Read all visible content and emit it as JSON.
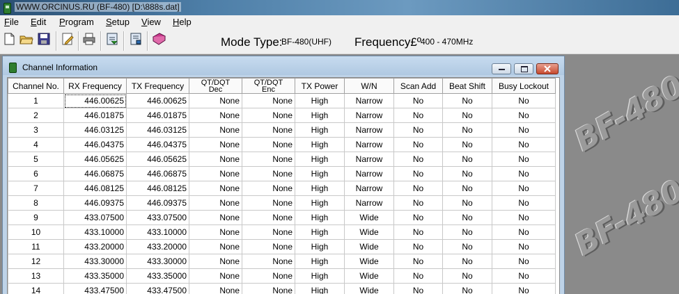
{
  "window": {
    "title": "WWW.ORCINUS.RU (BF-480) [D:\\888s.dat]"
  },
  "menu": [
    {
      "label": "File",
      "key": "F",
      "rest": "ile"
    },
    {
      "label": "Edit",
      "key": "E",
      "rest": "dit"
    },
    {
      "label": "Program",
      "key": "P",
      "rest": "rogram"
    },
    {
      "label": "Setup",
      "key": "S",
      "rest": "etup"
    },
    {
      "label": "View",
      "key": "V",
      "rest": "iew"
    },
    {
      "label": "Help",
      "key": "H",
      "rest": "elp"
    }
  ],
  "toolbar": {
    "icons": [
      "new-file-icon",
      "open-folder-icon",
      "save-icon",
      "edit-icon",
      "print-icon",
      "read-from-radio-icon",
      "write-to-radio-icon",
      "help-book-icon"
    ],
    "mode_label": "Mode Type:",
    "mode_value": "BF-480(UHF)",
    "freq_label": "Frequency£º",
    "freq_value": "400 - 470MHz"
  },
  "watermark": "BF-480",
  "child": {
    "title": "Channel Information",
    "columns": [
      "Channel No.",
      "RX Frequency",
      "TX Frequency",
      "QT/DQT Dec",
      "QT/DQT Enc",
      "TX Power",
      "W/N",
      "Scan Add",
      "Beat Shift",
      "Busy Lockout"
    ],
    "column_header_lines": {
      "3": [
        "QT/DQT",
        "Dec"
      ],
      "4": [
        "QT/DQT",
        "Enc"
      ]
    },
    "rows": [
      [
        "1",
        "446.00625",
        "446.00625",
        "None",
        "None",
        "High",
        "Narrow",
        "No",
        "No",
        "No"
      ],
      [
        "2",
        "446.01875",
        "446.01875",
        "None",
        "None",
        "High",
        "Narrow",
        "No",
        "No",
        "No"
      ],
      [
        "3",
        "446.03125",
        "446.03125",
        "None",
        "None",
        "High",
        "Narrow",
        "No",
        "No",
        "No"
      ],
      [
        "4",
        "446.04375",
        "446.04375",
        "None",
        "None",
        "High",
        "Narrow",
        "No",
        "No",
        "No"
      ],
      [
        "5",
        "446.05625",
        "446.05625",
        "None",
        "None",
        "High",
        "Narrow",
        "No",
        "No",
        "No"
      ],
      [
        "6",
        "446.06875",
        "446.06875",
        "None",
        "None",
        "High",
        "Narrow",
        "No",
        "No",
        "No"
      ],
      [
        "7",
        "446.08125",
        "446.08125",
        "None",
        "None",
        "High",
        "Narrow",
        "No",
        "No",
        "No"
      ],
      [
        "8",
        "446.09375",
        "446.09375",
        "None",
        "None",
        "High",
        "Narrow",
        "No",
        "No",
        "No"
      ],
      [
        "9",
        "433.07500",
        "433.07500",
        "None",
        "None",
        "High",
        "Wide",
        "No",
        "No",
        "No"
      ],
      [
        "10",
        "433.10000",
        "433.10000",
        "None",
        "None",
        "High",
        "Wide",
        "No",
        "No",
        "No"
      ],
      [
        "11",
        "433.20000",
        "433.20000",
        "None",
        "None",
        "High",
        "Wide",
        "No",
        "No",
        "No"
      ],
      [
        "12",
        "433.30000",
        "433.30000",
        "None",
        "None",
        "High",
        "Wide",
        "No",
        "No",
        "No"
      ],
      [
        "13",
        "433.35000",
        "433.35000",
        "None",
        "None",
        "High",
        "Wide",
        "No",
        "No",
        "No"
      ],
      [
        "14",
        "433.47500",
        "433.47500",
        "None",
        "None",
        "High",
        "Wide",
        "No",
        "No",
        "No"
      ]
    ]
  }
}
